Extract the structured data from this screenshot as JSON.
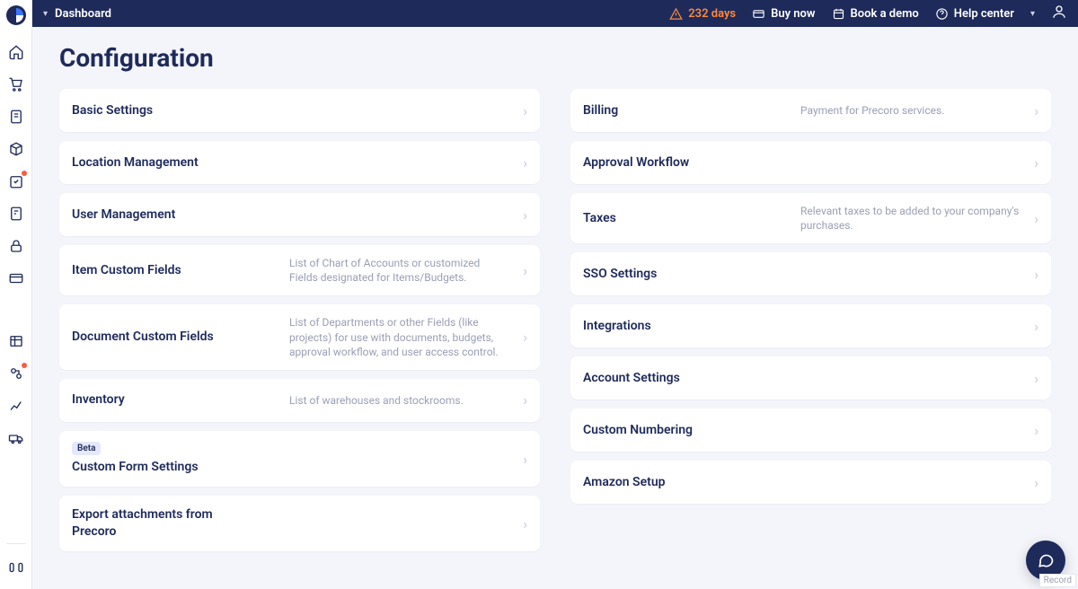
{
  "header": {
    "breadcrumb": "Dashboard",
    "warning": "232 days",
    "buy": "Buy now",
    "book": "Book a demo",
    "help": "Help center"
  },
  "page": {
    "title": "Configuration",
    "beta": "Beta"
  },
  "left": [
    {
      "name": "Basic Settings",
      "desc": ""
    },
    {
      "name": "Location Management",
      "desc": ""
    },
    {
      "name": "User Management",
      "desc": ""
    },
    {
      "name": "Item Custom Fields",
      "desc": "List of Chart of Accounts or customized Fields designated for Items/Budgets."
    },
    {
      "name": "Document Custom Fields",
      "desc": "List of Departments or other Fields (like projects) for use with documents, budgets, approval workflow, and user access control."
    },
    {
      "name": "Inventory",
      "desc": "List of warehouses and stockrooms."
    },
    {
      "name": "Custom Form Settings",
      "desc": "",
      "badge": true
    },
    {
      "name": "Export attachments from Precoro",
      "desc": ""
    }
  ],
  "right": [
    {
      "name": "Billing",
      "desc": "Payment for Precoro services."
    },
    {
      "name": "Approval Workflow",
      "desc": ""
    },
    {
      "name": "Taxes",
      "desc": "Relevant taxes to be added to your company's purchases."
    },
    {
      "name": "SSO Settings",
      "desc": ""
    },
    {
      "name": "Integrations",
      "desc": ""
    },
    {
      "name": "Account Settings",
      "desc": ""
    },
    {
      "name": "Custom Numbering",
      "desc": ""
    },
    {
      "name": "Amazon Setup",
      "desc": ""
    }
  ],
  "footer": {
    "record": "Record"
  }
}
